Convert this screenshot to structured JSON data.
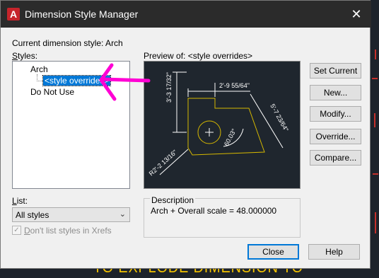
{
  "window": {
    "title": "Dimension Style Manager",
    "app_icon": "A"
  },
  "current_style": {
    "label": "Current dimension style: Arch"
  },
  "styles": {
    "label_first": "S",
    "label_rest": "tyles:",
    "items": [
      "Arch",
      "<style overrides>",
      "Do Not Use"
    ]
  },
  "preview": {
    "label": "Preview of: <style overrides>",
    "dims": [
      "3'-3 17/32\"",
      "2'-9 55/64\"",
      "5'-7 23/64\"",
      "60.03°",
      "R2'-2 13/16\""
    ]
  },
  "description": {
    "title": "Description",
    "text": "Arch + Overall scale = 48.000000"
  },
  "list": {
    "label_first": "L",
    "label_rest": "ist:",
    "selected": "All styles"
  },
  "xrefs": {
    "label_first": "D",
    "label_rest": "on't list styles in Xrefs",
    "checked": true
  },
  "buttons": {
    "set_current": "Set Current",
    "new": "New...",
    "modify": "Modify...",
    "override": "Override...",
    "compare": "Compare...",
    "close": "Close",
    "help": "Help"
  },
  "background": {
    "text": "TO  EXPLODE  DIMENSION  TO"
  },
  "colors": {
    "accent": "#0078d7",
    "annotation": "#ff00d4",
    "cad_yellow": "#d6b800",
    "cad_bg": "#1f262e"
  }
}
